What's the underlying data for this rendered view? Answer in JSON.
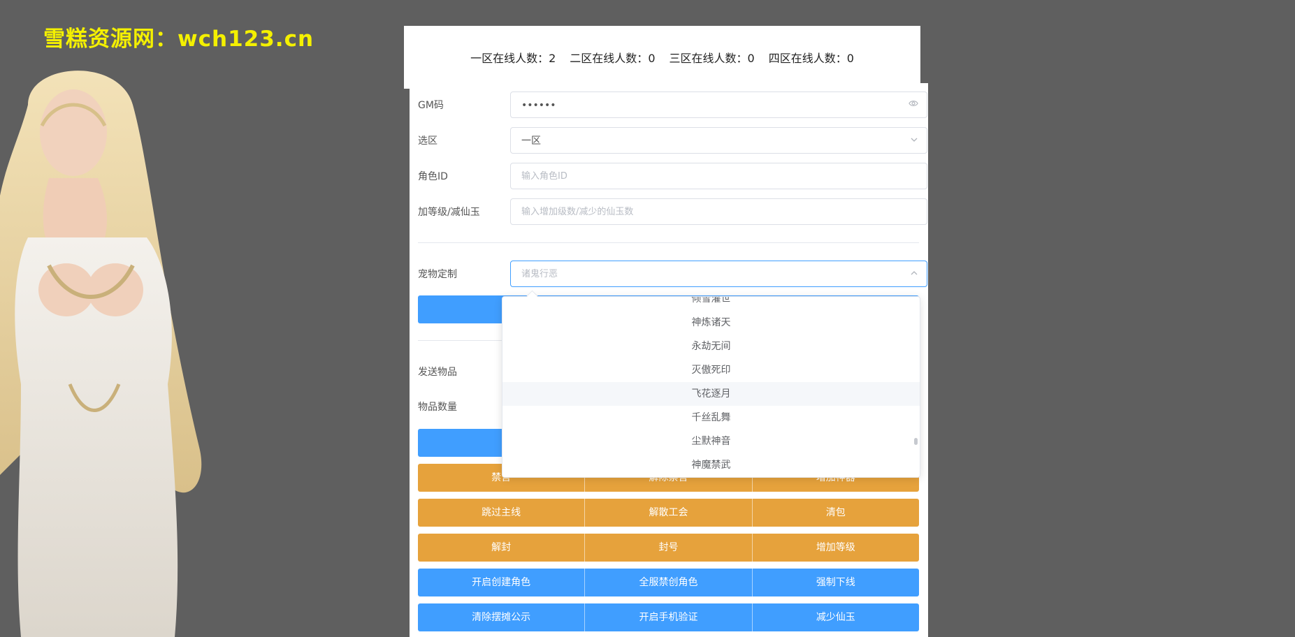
{
  "watermark": "雪糕资源网：wch123.cn",
  "online": [
    {
      "label": "一区在线人数：",
      "count": "2"
    },
    {
      "label": "二区在线人数：",
      "count": "0"
    },
    {
      "label": "三区在线人数：",
      "count": "0"
    },
    {
      "label": "四区在线人数：",
      "count": "0"
    }
  ],
  "form": {
    "gm_code": {
      "label": "GM码",
      "value": "••••••",
      "icon": "eye-icon"
    },
    "zone": {
      "label": "选区",
      "value": "一区",
      "icon": "chevron-down-icon"
    },
    "role_id": {
      "label": "角色ID",
      "placeholder": "输入角色ID"
    },
    "level_jade": {
      "label": "加等级/减仙玉",
      "placeholder": "输入增加级数/减少的仙玉数"
    },
    "pet": {
      "label": "宠物定制",
      "placeholder": "诸鬼行恶",
      "icon": "chevron-up-icon"
    },
    "send_item": {
      "label": "发送物品"
    },
    "item_qty": {
      "label": "物品数量"
    }
  },
  "dropdown": {
    "options": [
      "倾雪灌世",
      "神炼诸天",
      "永劫无间",
      "灭傲死印",
      "飞花逐月",
      "千丝乱舞",
      "尘默神音",
      "神魔禁武"
    ],
    "hovered_index": 4
  },
  "buttons": {
    "row1": [
      "禁言",
      "解除禁言",
      "增加神器"
    ],
    "row2": [
      "跳过主线",
      "解散工会",
      "清包"
    ],
    "row3": [
      "解封",
      "封号",
      "增加等级"
    ],
    "row4": [
      "开启创建角色",
      "全服禁创角色",
      "强制下线"
    ],
    "row5": [
      "清除摆摊公示",
      "开启手机验证",
      "减少仙玉"
    ]
  },
  "colors": {
    "primary": "#409eff",
    "warning": "#e6a23c",
    "watermark": "#f4f000"
  }
}
